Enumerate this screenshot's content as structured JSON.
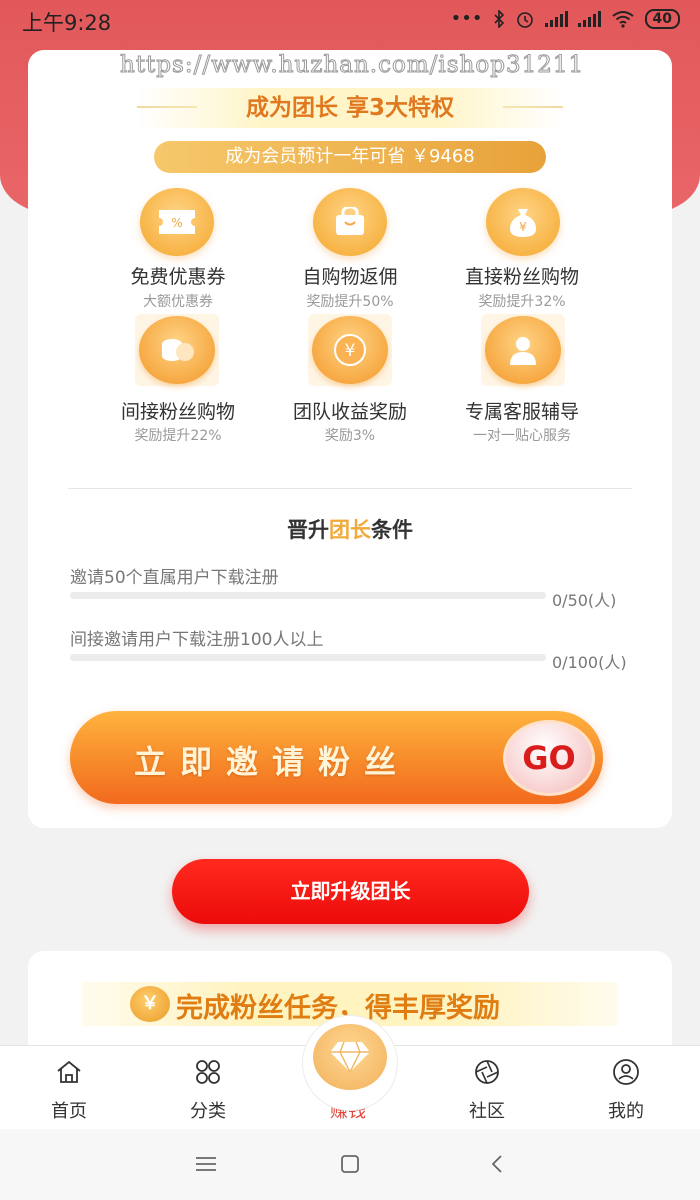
{
  "status_bar": {
    "time": "上午9:28",
    "battery": "40"
  },
  "watermark": "https://www.huzhan.com/ishop31211",
  "header": {
    "title": "成为团长 享3大特权",
    "savings": "成为会员预计一年可省 ￥9468"
  },
  "privileges": [
    {
      "icon": "coupon-icon",
      "title": "免费优惠券",
      "subtitle": "大额优惠券"
    },
    {
      "icon": "shopping-bag-icon",
      "title": "自购物返佣",
      "subtitle": "奖励提升50%"
    },
    {
      "icon": "money-bag-icon",
      "title": "直接粉丝购物",
      "subtitle": "奖励提升32%"
    },
    {
      "icon": "coins-icon",
      "title": "间接粉丝购物",
      "subtitle": "奖励提升22%"
    },
    {
      "icon": "yen-coin-icon",
      "title": "团队收益奖励",
      "subtitle": "奖励3%"
    },
    {
      "icon": "service-person-icon",
      "title": "专属客服辅导",
      "subtitle": "一对一贴心服务"
    }
  ],
  "conditions": {
    "title_prefix": "晋升",
    "title_highlight": "团长",
    "title_suffix": "条件",
    "items": [
      {
        "label": "邀请50个直属用户下载注册",
        "count": "0/50(人)",
        "progress": 0
      },
      {
        "label": "间接邀请用户下载注册100人以上",
        "count": "0/100(人)",
        "progress": 0
      }
    ]
  },
  "invite_button": {
    "label": "立即邀请粉丝",
    "go": "GO"
  },
  "upgrade_button": "立即升级团长",
  "task_banner": {
    "coin": "￥",
    "title": "完成粉丝任务，得丰厚奖励"
  },
  "tabbar": {
    "items": [
      {
        "label": "首页",
        "icon": "home-icon",
        "active": false
      },
      {
        "label": "分类",
        "icon": "category-icon",
        "active": false
      },
      {
        "label": "赚钱",
        "icon": "diamond-icon",
        "active": true
      },
      {
        "label": "社区",
        "icon": "shutter-icon",
        "active": false
      },
      {
        "label": "我的",
        "icon": "user-icon",
        "active": false
      }
    ]
  },
  "colors": {
    "header_red": "#e2585a",
    "accent_orange": "#f0a93a",
    "upgrade_red": "#ec0b0b",
    "active_tab": "#e2453a"
  }
}
